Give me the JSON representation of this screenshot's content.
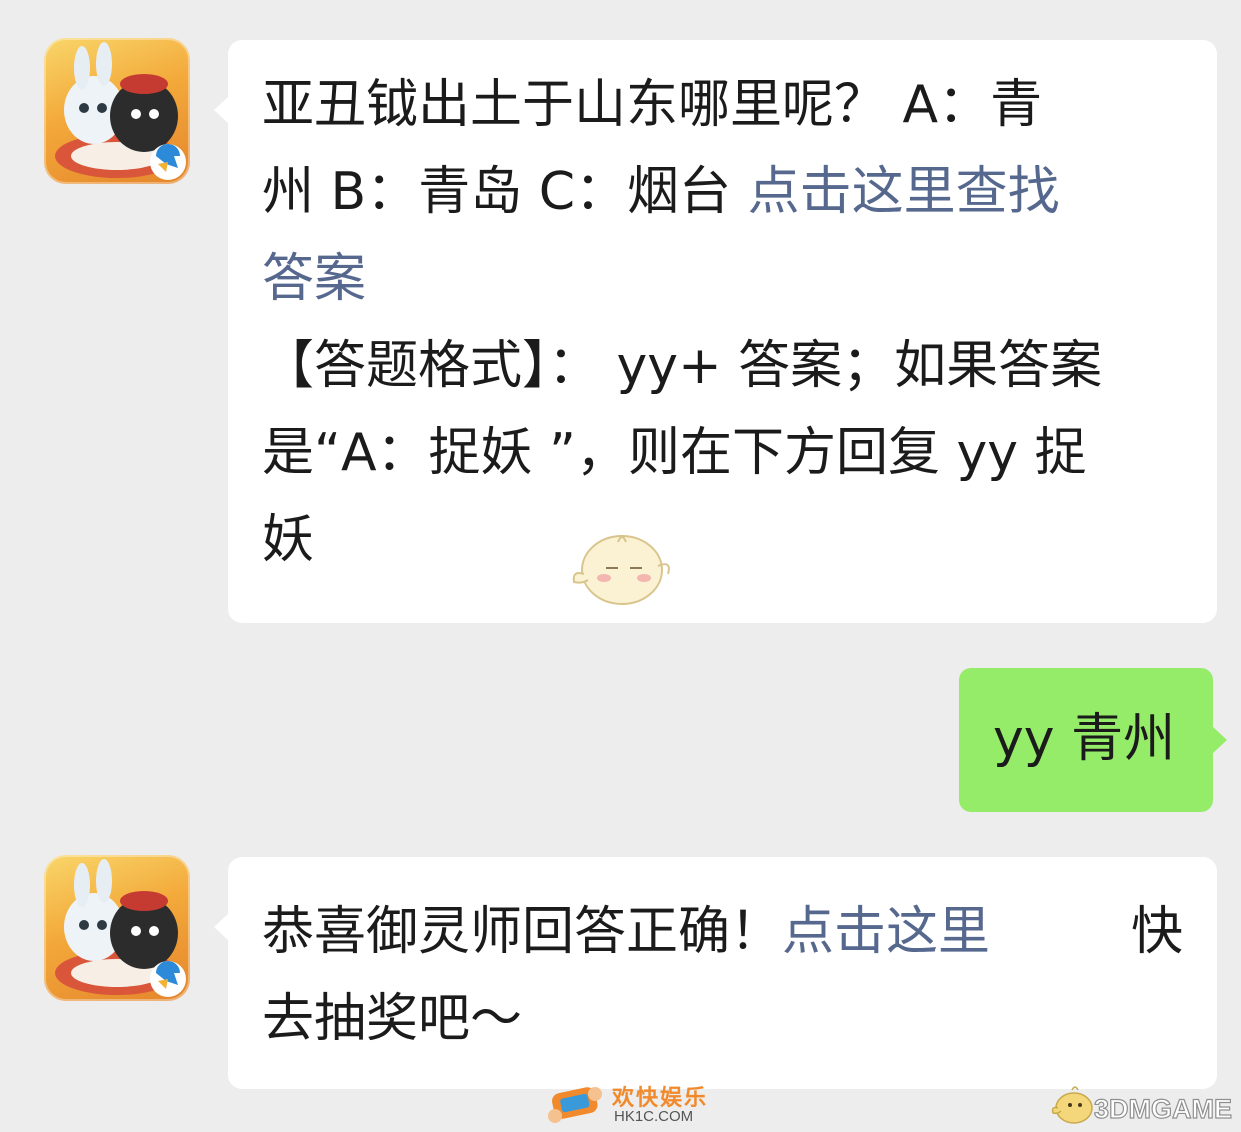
{
  "messages": [
    {
      "sender": "bot",
      "q_line1": "亚丑钺出土于山东哪里呢？ A：青",
      "q_line2_text": "州 B：青岛 C：烟台 ",
      "q_line2_link": "点击这里查找",
      "q_line3_link": "答案",
      "fmt_line1": "【答题格式】：  yy+ 答案；如果答案",
      "fmt_line2": "是“A：捉妖 ”，则在下方回复 yy 捉",
      "fmt_line3": "妖"
    },
    {
      "sender": "me",
      "text": "yy 青州"
    },
    {
      "sender": "bot",
      "r_line1_text": "恭喜御灵师回答正确！",
      "r_line1_link": "点击这里",
      "r_line1_tail": "快",
      "r_line2": "去抽奖吧～"
    }
  ],
  "watermarks": {
    "hk1c_title": "欢快娱乐",
    "hk1c_domain": "HK1C.COM",
    "site_3dm": "3DMGAME"
  },
  "colors": {
    "background": "#ededed",
    "incoming_bubble": "#ffffff",
    "outgoing_bubble": "#95ec69",
    "link": "#57688f",
    "text": "#1b1b1b"
  }
}
